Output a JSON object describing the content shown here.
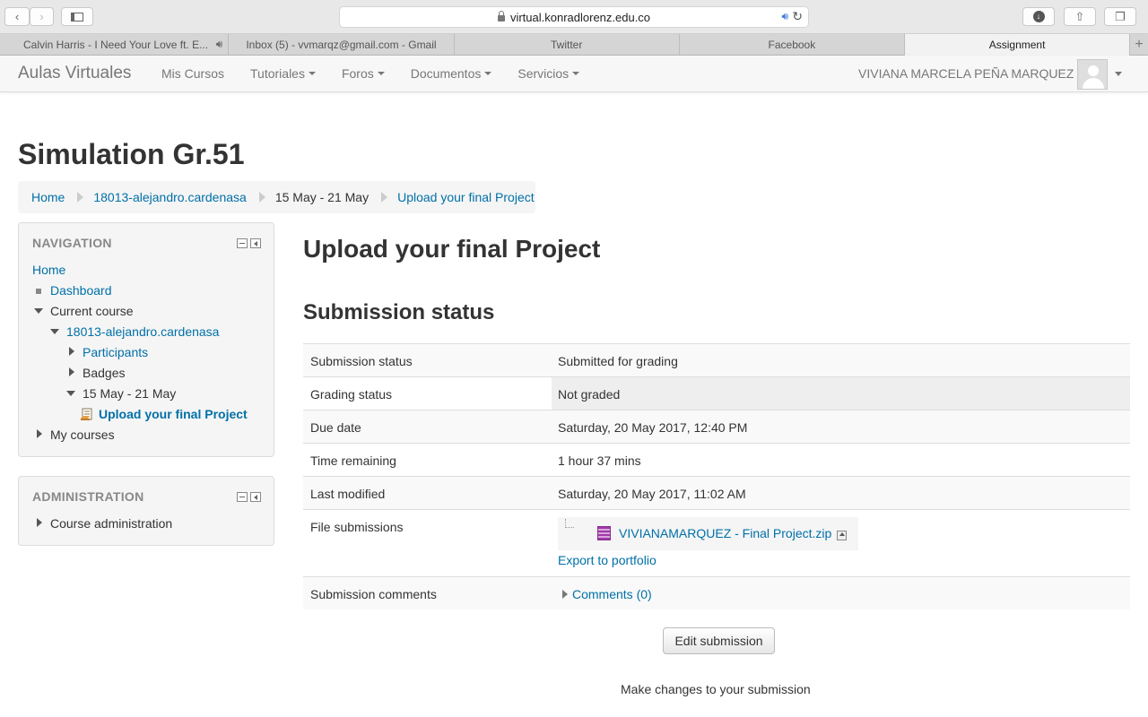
{
  "browser": {
    "url": "virtual.konradlorenz.edu.co",
    "tabs": [
      {
        "label": "Calvin Harris - I Need Your Love ft. E..."
      },
      {
        "label": "Inbox (5) - vvmarqz@gmail.com - Gmail"
      },
      {
        "label": "Twitter"
      },
      {
        "label": "Facebook"
      },
      {
        "label": "Assignment"
      }
    ]
  },
  "navbar": {
    "brand": "Aulas Virtuales",
    "menu": [
      "Mis Cursos",
      "Tutoriales",
      "Foros",
      "Documentos",
      "Servicios"
    ],
    "user_name": "VIVIANA MARCELA PEÑA MARQUEZ"
  },
  "page": {
    "course_title": "Simulation Gr.51",
    "breadcrumb": [
      "Home",
      "18013-alejandro.cardenasa",
      "15 May - 21 May",
      "Upload your final Project"
    ]
  },
  "navigation_block": {
    "title": "NAVIGATION",
    "home": "Home",
    "dashboard": "Dashboard",
    "current_course": "Current course",
    "course": "18013-alejandro.cardenasa",
    "participants": "Participants",
    "badges": "Badges",
    "week": "15 May - 21 May",
    "activity": "Upload your final Project",
    "my_courses": "My courses"
  },
  "admin_block": {
    "title": "ADMINISTRATION",
    "course_admin": "Course administration"
  },
  "main": {
    "activity_title": "Upload your final Project",
    "status_heading": "Submission status",
    "rows": [
      {
        "label": "Submission status",
        "value": "Submitted for grading"
      },
      {
        "label": "Grading status",
        "value": "Not graded"
      },
      {
        "label": "Due date",
        "value": "Saturday, 20 May 2017, 12:40 PM"
      },
      {
        "label": "Time remaining",
        "value": "1 hour 37 mins"
      },
      {
        "label": "Last modified",
        "value": "Saturday, 20 May 2017, 11:02 AM"
      },
      {
        "label": "File submissions",
        "file_name": "VIVIANAMARQUEZ - Final Project.zip",
        "export_label": "Export to portfolio"
      },
      {
        "label": "Submission comments",
        "value": "Comments (0)"
      }
    ],
    "edit_button": "Edit submission",
    "help_text": "Make changes to your submission"
  },
  "colors": {
    "link": "#0070a8",
    "block_bg": "#f5f5f5",
    "text": "#333333"
  }
}
